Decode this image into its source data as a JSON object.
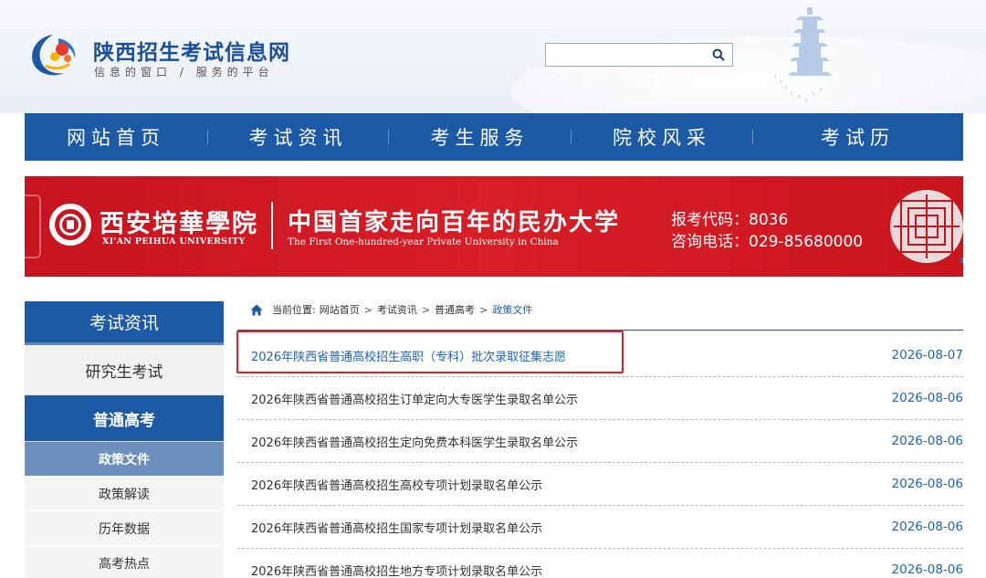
{
  "header": {
    "site_title": "陕西招生考试信息网",
    "site_slogan": "信息的窗口 / 服务的平台",
    "search": {
      "placeholder": "",
      "value": ""
    }
  },
  "nav": {
    "items": [
      {
        "label": "网站首页"
      },
      {
        "label": "考试资讯"
      },
      {
        "label": "考生服务"
      },
      {
        "label": "院校风采"
      },
      {
        "label": "考试历"
      }
    ]
  },
  "banner": {
    "university_name": "西安培華學院",
    "university_en": "XI'AN PEIHUA UNIVERSITY",
    "slogan": "中国首家走向百年的民办大学",
    "slogan_en": "The First One-hundred-year Private University in China",
    "code_text": "报考代码：8036",
    "phone_text": "咨询电话：029-85680000",
    "brand_color": "#d81e27"
  },
  "sidebar": {
    "heading": "考试资讯",
    "items": [
      {
        "label": "研究生考试",
        "active": false
      },
      {
        "label": "普通高考",
        "active": true
      }
    ],
    "subitems": [
      {
        "label": "政策文件",
        "current": true
      },
      {
        "label": "政策解读",
        "current": false
      },
      {
        "label": "历年数据",
        "current": false
      },
      {
        "label": "高考热点",
        "current": false
      }
    ]
  },
  "breadcrumb": {
    "prefix": "当前位置:",
    "items": [
      "网站首页",
      "考试资讯",
      "普通高考",
      "政策文件"
    ]
  },
  "news": [
    {
      "title": "2026年陕西省普通高校招生高职（专科）批次录取征集志愿",
      "date": "2026-08-07"
    },
    {
      "title": "2026年陕西省普通高校招生订单定向大专医学生录取名单公示",
      "date": "2026-08-06"
    },
    {
      "title": "2026年陕西省普通高校招生定向免费本科医学生录取名单公示",
      "date": "2026-08-06"
    },
    {
      "title": "2026年陕西省普通高校招生高校专项计划录取名单公示",
      "date": "2026-08-06"
    },
    {
      "title": "2026年陕西省普通高校招生国家专项计划录取名单公示",
      "date": "2026-08-06"
    },
    {
      "title": "2026年陕西省普通高校招生地方专项计划录取名单公示",
      "date": "2026-08-06"
    }
  ],
  "colors": {
    "primary": "#1c5aa5",
    "link": "#1c63b8",
    "highlight": "#e02020"
  }
}
